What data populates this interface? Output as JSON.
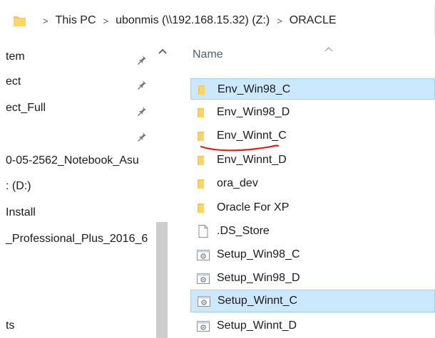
{
  "address_bar": {
    "crumbs": [
      "This PC",
      "ubonmis (\\\\192.168.15.32) (Z:)",
      "ORACLE"
    ],
    "separator": ">"
  },
  "nav": {
    "items": [
      {
        "label": "tem",
        "pinned": true
      },
      {
        "label": "ect",
        "pinned": true
      },
      {
        "label": "ect_Full",
        "pinned": true
      },
      {
        "label": "",
        "pinned": true
      },
      {
        "label": "0-05-2562_Notebook_Asu",
        "pinned": false
      },
      {
        "label": ": (D:)",
        "pinned": false
      },
      {
        "label": "Install",
        "pinned": false
      },
      {
        "label": "_Professional_Plus_2016_6",
        "pinned": false
      },
      {
        "label": "",
        "pinned": false
      },
      {
        "label": "",
        "pinned": false
      },
      {
        "label": "",
        "pinned": false
      },
      {
        "label": "ts",
        "pinned": false
      }
    ]
  },
  "file_list": {
    "column_header": "Name",
    "rows": [
      {
        "name": "Env_Win98_C",
        "type": "folder",
        "selected": true
      },
      {
        "name": "Env_Win98_D",
        "type": "folder",
        "selected": false
      },
      {
        "name": "Env_Winnt_C",
        "type": "folder",
        "selected": false
      },
      {
        "name": "Env_Winnt_D",
        "type": "folder",
        "selected": false
      },
      {
        "name": "ora_dev",
        "type": "folder",
        "selected": false
      },
      {
        "name": "Oracle For XP",
        "type": "folder",
        "selected": false
      },
      {
        "name": ".DS_Store",
        "type": "file",
        "selected": false
      },
      {
        "name": "Setup_Win98_C",
        "type": "setup",
        "selected": false
      },
      {
        "name": "Setup_Win98_D",
        "type": "setup",
        "selected": false
      },
      {
        "name": "Setup_Winnt_C",
        "type": "setup",
        "selected": true
      },
      {
        "name": "Setup_Winnt_D",
        "type": "setup",
        "selected": false
      }
    ]
  },
  "colors": {
    "selection_bg": "#cce8ff",
    "selection_border": "#99d1ff",
    "folder_yellow": "#f8c94a",
    "annotation_red": "#e0201b",
    "header_text": "#4c607a"
  },
  "icons": {
    "folder": "folder-icon",
    "file": "file-icon",
    "setup": "setup-icon",
    "pin": "pin-icon"
  }
}
